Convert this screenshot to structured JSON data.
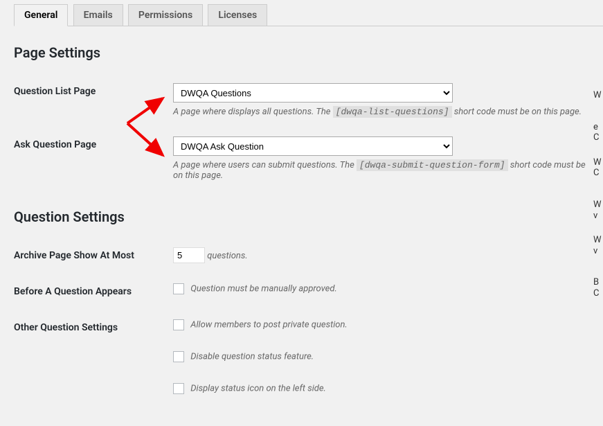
{
  "tabs": [
    {
      "label": "General",
      "active": true
    },
    {
      "label": "Emails",
      "active": false
    },
    {
      "label": "Permissions",
      "active": false
    },
    {
      "label": "Licenses",
      "active": false
    }
  ],
  "sections": {
    "page_settings": {
      "heading": "Page Settings",
      "rows": {
        "question_list": {
          "label": "Question List Page",
          "selected": "DWQA Questions",
          "desc_before": "A page where displays all questions. The ",
          "shortcode": "[dwqa-list-questions]",
          "desc_after": " short code must be on this page."
        },
        "ask_question": {
          "label": "Ask Question Page",
          "selected": "DWQA Ask Question",
          "desc_before": "A page where users can submit questions. The ",
          "shortcode": "[dwqa-submit-question-form]",
          "desc_after": " short code must be on this page."
        }
      }
    },
    "question_settings": {
      "heading": "Question Settings",
      "rows": {
        "archive": {
          "label": "Archive Page Show At Most",
          "value": "5",
          "suffix": "questions."
        },
        "before_appears": {
          "label": "Before A Question Appears",
          "checkbox_label": "Question must be manually approved."
        },
        "other": {
          "label": "Other Question Settings",
          "options": [
            "Allow members to post private question.",
            "Disable question status feature.",
            "Display status icon on the left side."
          ]
        }
      }
    }
  },
  "sidebar_fragments": [
    "W",
    "e",
    "C",
    "W",
    "C",
    "W",
    "v",
    "W",
    "v",
    "B",
    "C"
  ],
  "arrow_color": "#F00000"
}
